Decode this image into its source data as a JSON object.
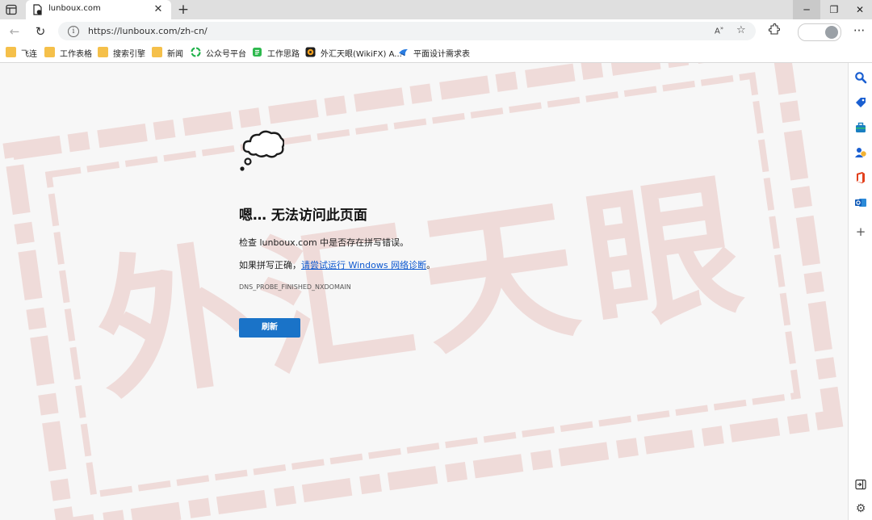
{
  "tab": {
    "title": "lunboux.com"
  },
  "address": {
    "url": "https://lunboux.com/zh-cn/"
  },
  "profile": {
    "label": ""
  },
  "bookmarks": [
    {
      "label": "飞连",
      "icon": "folder-icon"
    },
    {
      "label": "工作表格",
      "icon": "folder-icon"
    },
    {
      "label": "搜索引擎",
      "icon": "folder-icon"
    },
    {
      "label": "新闻",
      "icon": "folder-icon"
    },
    {
      "label": "公众号平台",
      "icon": "wechat-icon"
    },
    {
      "label": "工作思路",
      "icon": "mindmap-icon"
    },
    {
      "label": "外汇天眼(WikiFX) A...",
      "icon": "wikifx-icon"
    },
    {
      "label": "平面设计需求表",
      "icon": "bird-icon"
    }
  ],
  "error": {
    "title": "嗯… 无法访问此页面",
    "line1": "检查 lunboux.com 中是否存在拼写错误。",
    "line2_prefix": "如果拼写正确，",
    "line2_link": "请尝试运行 Windows 网络诊断",
    "line2_suffix": "。",
    "code": "DNS_PROBE_FINISHED_NXDOMAIN",
    "refresh_label": "刷新"
  },
  "watermark": {
    "text": "外汇天眼"
  },
  "colors": {
    "accent": "#1a73c8",
    "link": "#0b57d0",
    "watermark": "#c0392b"
  }
}
